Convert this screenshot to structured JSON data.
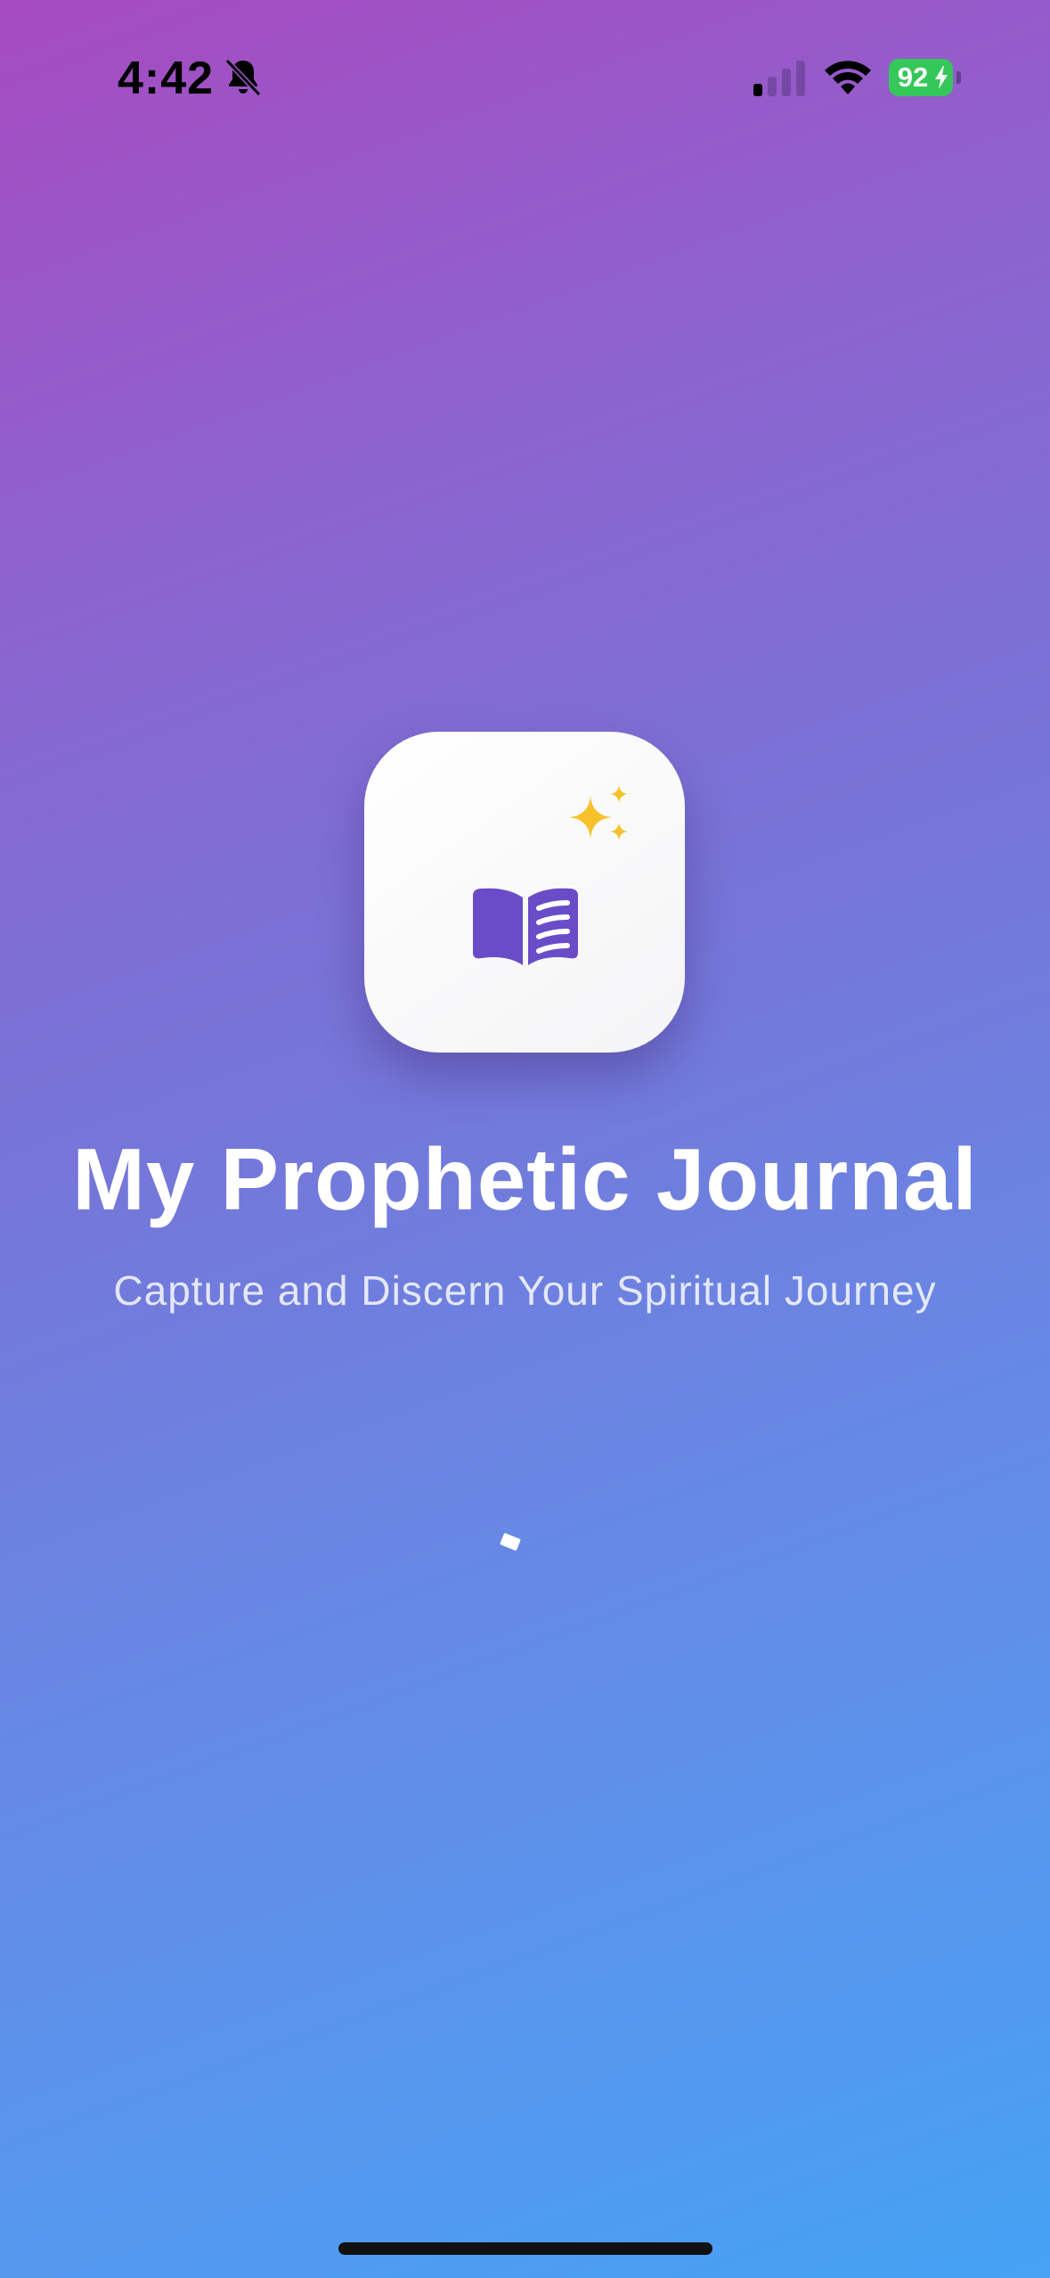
{
  "status_bar": {
    "time": "4:42",
    "battery_percent": "92",
    "battery_color": "#34c759",
    "icons": [
      "bell-slash-icon",
      "cellular-signal-icon",
      "wifi-icon",
      "battery-icon",
      "charging-bolt-icon"
    ]
  },
  "app_icon": {
    "icons": [
      "sparkles-icon",
      "open-book-icon"
    ],
    "book_color": "#6a4cc8",
    "sparkle_color": "#f6c22b"
  },
  "splash": {
    "title": "My Prophetic Journal",
    "subtitle": "Capture and Discern Your Spiritual Journey"
  },
  "colors": {
    "gradient_top": "#a64bc0",
    "gradient_bottom": "#45a2f4"
  }
}
